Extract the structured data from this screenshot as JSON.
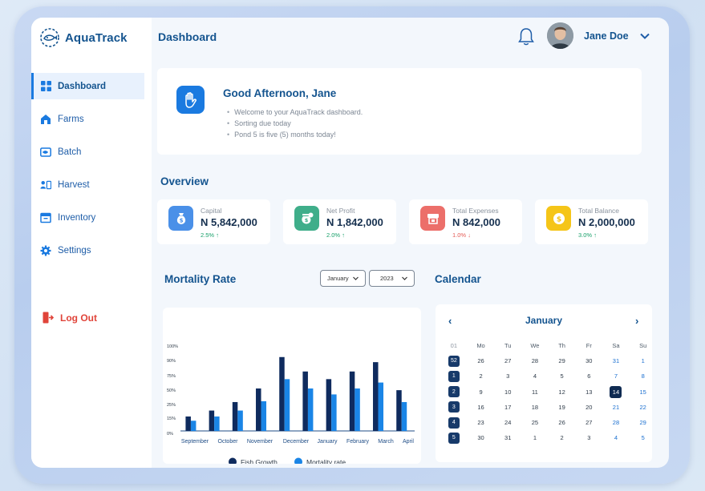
{
  "app": {
    "name": "AquaTrack"
  },
  "sidebar": {
    "items": [
      {
        "label": "Dashboard",
        "icon": "grid-icon",
        "active": true
      },
      {
        "label": "Farms",
        "icon": "farm-icon",
        "active": false
      },
      {
        "label": "Batch",
        "icon": "batch-icon",
        "active": false
      },
      {
        "label": "Harvest",
        "icon": "harvest-icon",
        "active": false
      },
      {
        "label": "Inventory",
        "icon": "inventory-icon",
        "active": false
      },
      {
        "label": "Settings",
        "icon": "gear-icon",
        "active": false
      }
    ],
    "logout_label": "Log Out"
  },
  "header": {
    "title": "Dashboard",
    "user_name": "Jane Doe"
  },
  "greeting": {
    "title": "Good Afternoon,  Jane",
    "lines": [
      "Welcome to your AquaTrack dashboard.",
      "Sorting due today",
      "Pond 5 is five (5) months today!"
    ]
  },
  "overview": {
    "title": "Overview",
    "stats": [
      {
        "label": "Capital",
        "value": "N 5,842,000",
        "change": "2.5%",
        "direction": "up",
        "color": "#4a90e8",
        "icon": "money-bag-icon"
      },
      {
        "label": "Net Profit",
        "value": "N 1,842,000",
        "change": "2.0%",
        "direction": "up",
        "color": "#3fae8a",
        "icon": "profit-bag-icon"
      },
      {
        "label": "Total Expenses",
        "value": "N 842,000",
        "change": "1.0%",
        "direction": "down",
        "color": "#ec6f6a",
        "icon": "register-icon"
      },
      {
        "label": "Total Balance",
        "value": "N 2,000,000",
        "change": "3.0%",
        "direction": "up",
        "color": "#f5c518",
        "icon": "coin-icon"
      }
    ]
  },
  "mortality": {
    "title": "Mortality Rate",
    "month_select": "January",
    "year_select": "2023"
  },
  "chart_data": {
    "type": "bar",
    "categories": [
      "September",
      "October",
      "November",
      "December",
      "January",
      "February",
      "March",
      "April"
    ],
    "series": [
      {
        "name": "Fish Growth",
        "values": [
          17,
          24,
          34,
          50,
          87,
          70,
          61,
          70,
          81,
          48
        ],
        "color": "#0f2b5e"
      },
      {
        "name": "Mortality rate",
        "values": [
          12,
          17,
          24,
          35,
          61,
          50,
          43,
          50,
          57,
          34
        ],
        "color": "#1a85e6"
      }
    ],
    "y_ticks": [
      "100%",
      "90%",
      "75%",
      "50%",
      "25%",
      "15%",
      "0%"
    ],
    "ylim": [
      0,
      100
    ],
    "legend": "bottom",
    "grid": false
  },
  "calendar": {
    "title": "Calendar",
    "month": "January",
    "headers": [
      "01",
      "Mo",
      "Tu",
      "We",
      "Th",
      "Fr",
      "Sa",
      "Su"
    ],
    "rows": [
      [
        "52",
        "26",
        "27",
        "28",
        "29",
        "30",
        "31",
        "1"
      ],
      [
        "1",
        "2",
        "3",
        "4",
        "5",
        "6",
        "7",
        "8"
      ],
      [
        "2",
        "9",
        "10",
        "11",
        "12",
        "13",
        "14",
        "15"
      ],
      [
        "3",
        "16",
        "17",
        "18",
        "19",
        "20",
        "21",
        "22"
      ],
      [
        "4",
        "23",
        "24",
        "25",
        "26",
        "27",
        "28",
        "29"
      ],
      [
        "5",
        "30",
        "31",
        "1",
        "2",
        "3",
        "4",
        "5"
      ]
    ],
    "today": "14"
  }
}
